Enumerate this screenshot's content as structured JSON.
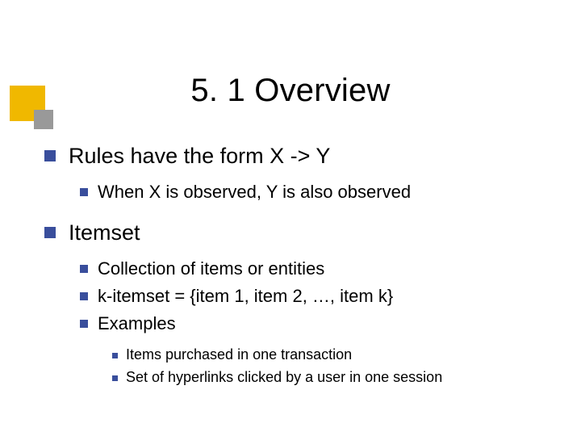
{
  "title": "5. 1 Overview",
  "bullets": {
    "item1": {
      "text": "Rules have the form X -> Y",
      "sub": {
        "a": "When X is observed, Y is also observed"
      }
    },
    "item2": {
      "text": "Itemset",
      "sub": {
        "a": "Collection of items or entities",
        "b": "k-itemset = {item 1, item 2, …, item k}",
        "c": "Examples",
        "c_sub": {
          "i": "Items purchased in one transaction",
          "ii": "Set of hyperlinks clicked by a user in one session"
        }
      }
    }
  }
}
